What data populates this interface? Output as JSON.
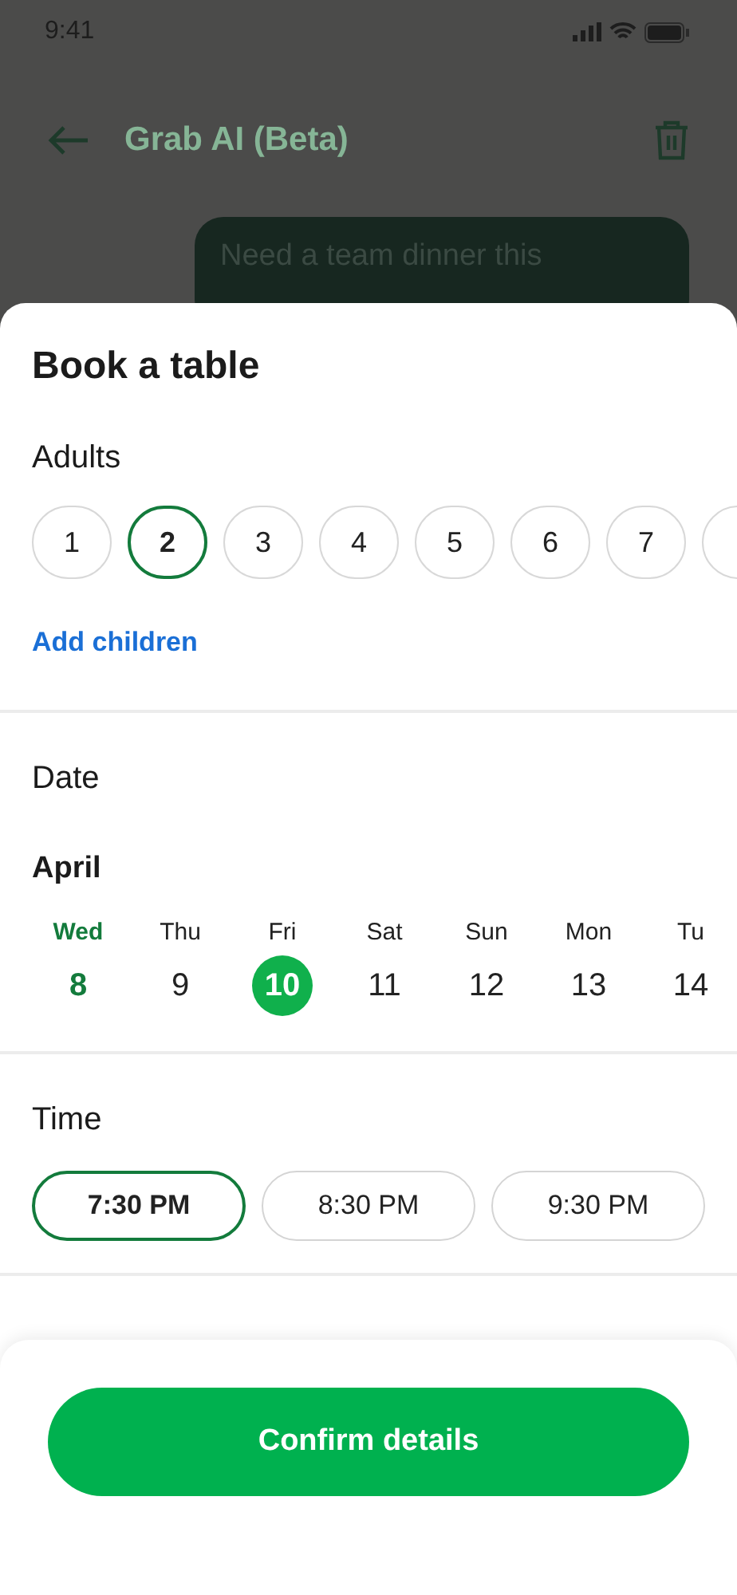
{
  "status_bar": {
    "time": "9:41"
  },
  "header": {
    "title": "Grab AI (Beta)"
  },
  "chat": {
    "message": "Need a team dinner this"
  },
  "sheet": {
    "title": "Book a table",
    "adults": {
      "label": "Adults",
      "options": [
        {
          "label": "1",
          "selected": false
        },
        {
          "label": "2",
          "selected": true
        },
        {
          "label": "3",
          "selected": false
        },
        {
          "label": "4",
          "selected": false
        },
        {
          "label": "5",
          "selected": false
        },
        {
          "label": "6",
          "selected": false
        },
        {
          "label": "7",
          "selected": false
        },
        {
          "selected": false
        }
      ],
      "link": "Add children"
    },
    "date": {
      "label": "Date",
      "month": "April",
      "days": [
        {
          "day": "Wed",
          "date": "8",
          "today": true,
          "selected": false
        },
        {
          "day": "Thu",
          "date": "9",
          "today": false,
          "selected": false
        },
        {
          "day": "Fri",
          "date": "10",
          "today": false,
          "selected": true
        },
        {
          "day": "Sat",
          "date": "11",
          "today": false,
          "selected": false
        },
        {
          "day": "Sun",
          "date": "12",
          "today": false,
          "selected": false
        },
        {
          "day": "Mon",
          "date": "13",
          "today": false,
          "selected": false
        },
        {
          "day": "Tu",
          "date": "14",
          "today": false,
          "selected": false
        }
      ]
    },
    "time": {
      "label": "Time",
      "options": [
        {
          "label": "7:30 PM",
          "selected": true
        },
        {
          "label": "8:30 PM",
          "selected": false
        },
        {
          "label": "9:30 PM",
          "selected": false
        }
      ]
    }
  },
  "footer": {
    "button": "Confirm details"
  }
}
